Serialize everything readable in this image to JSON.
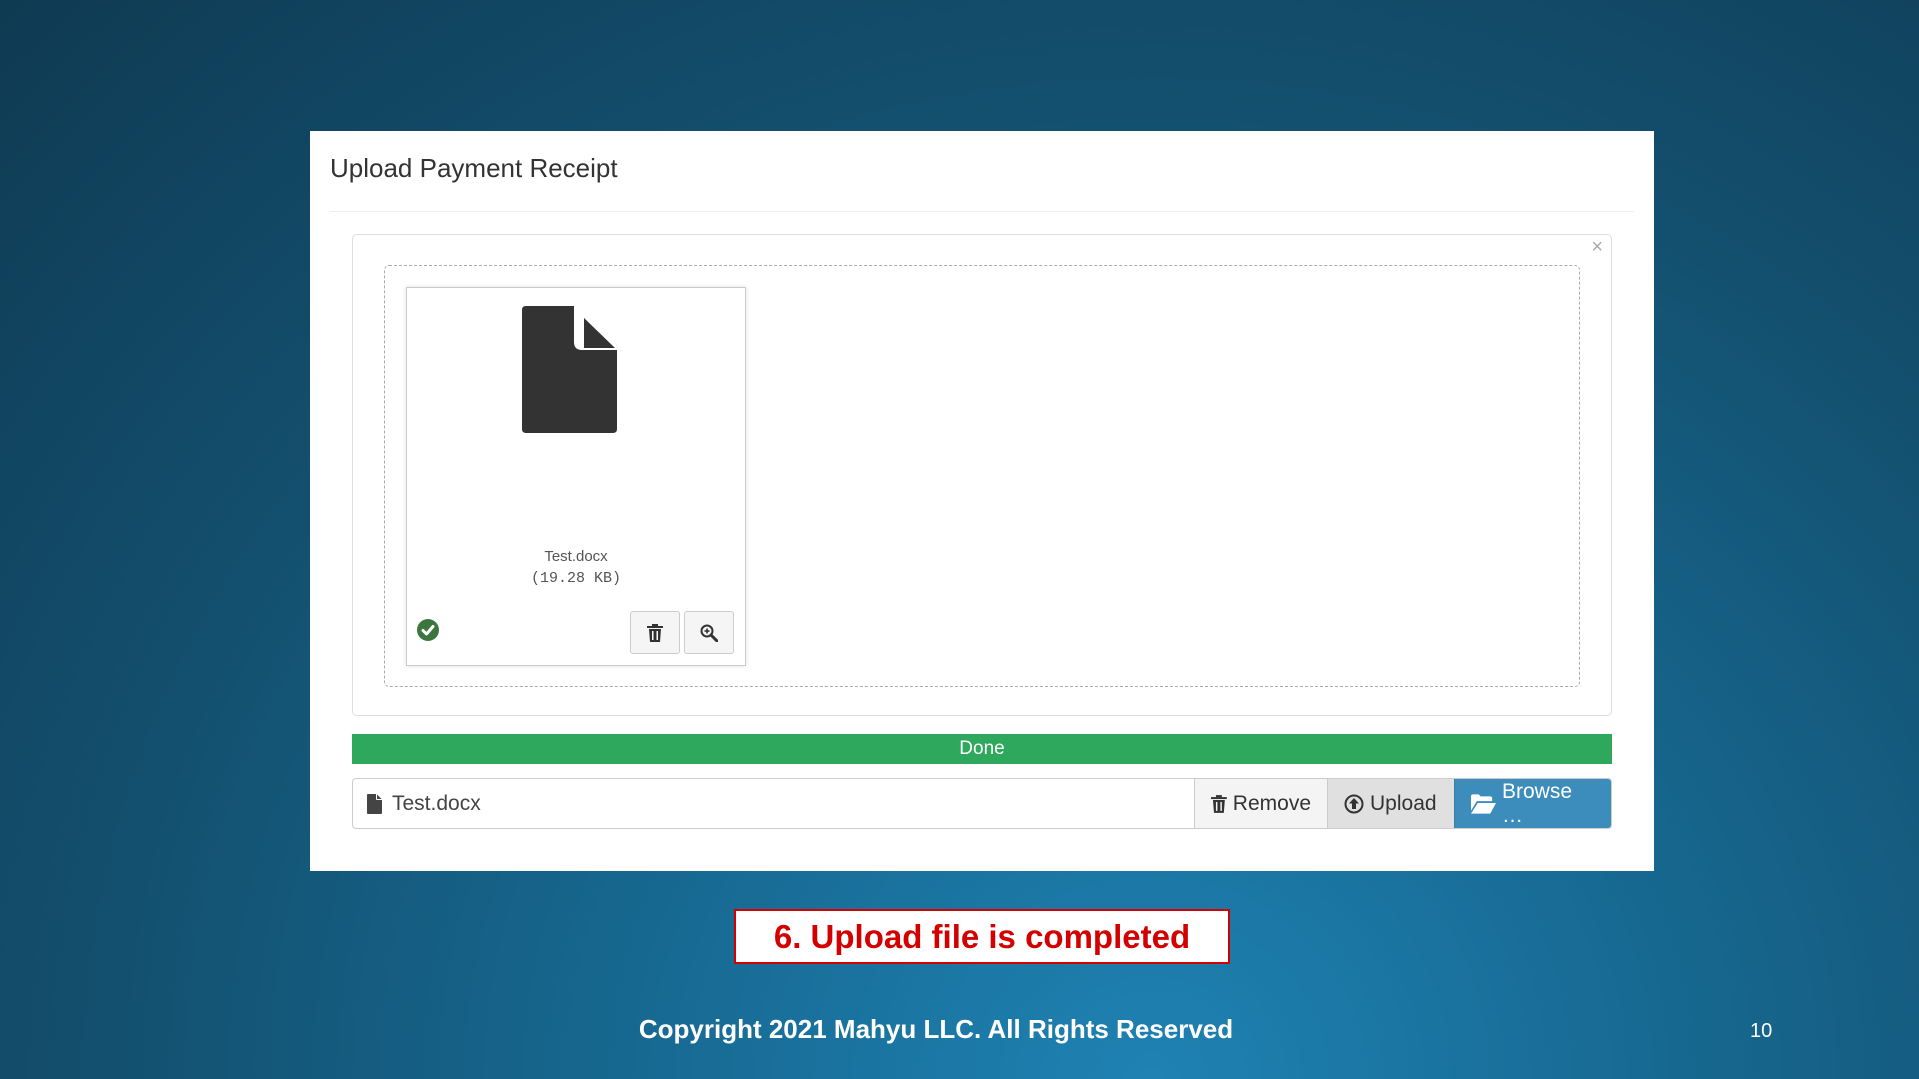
{
  "modal": {
    "title": "Upload Payment Receipt",
    "close_symbol": "×"
  },
  "preview": {
    "file_name": "Test.docx",
    "file_size": "(19.28 KB)",
    "status_icon": "check-circle-icon",
    "file_icon": "document-icon"
  },
  "progress": {
    "label": "Done",
    "percent": 100,
    "color": "#2ea85c"
  },
  "file_input": {
    "caption": "Test.docx",
    "remove_label": "Remove",
    "upload_label": "Upload",
    "browse_label": "Browse …",
    "browse_color": "#3c8dbc"
  },
  "slide": {
    "step_label": "6. Upload file is completed",
    "copyright": "Copyright 2021 Mahyu LLC. All Rights Reserved",
    "page_number": "10"
  }
}
